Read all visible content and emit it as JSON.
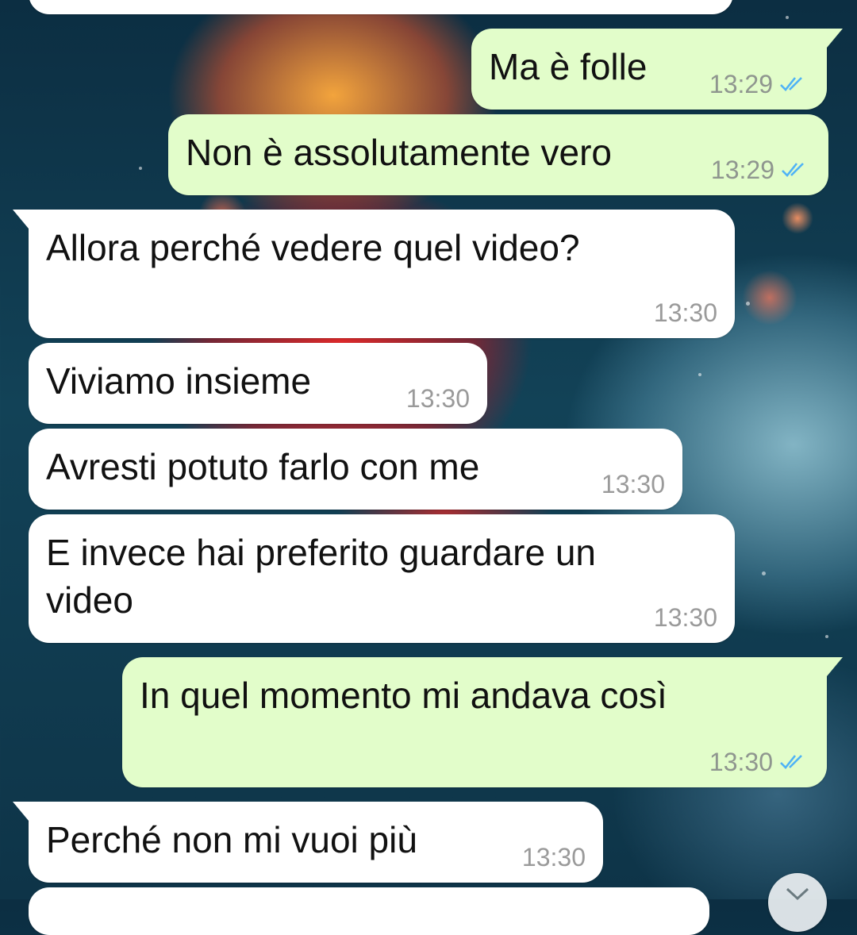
{
  "chat": {
    "messages": [
      {
        "direction": "out",
        "text": "Ma è folle",
        "time": "13:29",
        "status": "read"
      },
      {
        "direction": "out",
        "text": "Non è assolutamente vero",
        "time": "13:29",
        "status": "read"
      },
      {
        "direction": "in",
        "text": "Allora perché vedere quel video?",
        "time": "13:30"
      },
      {
        "direction": "in",
        "text": "Viviamo insieme",
        "time": "13:30"
      },
      {
        "direction": "in",
        "text": "Avresti potuto farlo con me",
        "time": "13:30"
      },
      {
        "direction": "in",
        "text_line1": "E invece hai preferito guardare un",
        "text_line2": "video",
        "time": "13:30"
      },
      {
        "direction": "out",
        "text": "In quel momento mi andava così",
        "time": "13:30",
        "status": "read"
      },
      {
        "direction": "in",
        "text": "Perché non mi vuoi più",
        "time": "13:30"
      }
    ]
  },
  "icons": {
    "read_receipt": "double-check-icon",
    "scroll_down": "chevron-down-icon"
  },
  "colors": {
    "incoming_bubble": "#ffffff",
    "outgoing_bubble": "#e2fdca",
    "read_tick": "#4fb3f6",
    "timestamp": "#9a9a9a"
  }
}
